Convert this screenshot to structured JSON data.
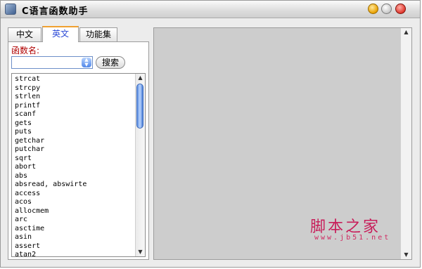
{
  "window": {
    "title": "C语言函数助手",
    "icon": "app-icon",
    "controls": [
      "minimize-button",
      "maximize-button",
      "close-button"
    ]
  },
  "tabs": [
    {
      "label": "中文",
      "active": false
    },
    {
      "label": "英文",
      "active": true
    },
    {
      "label": "功能集",
      "active": false
    }
  ],
  "search": {
    "label": "函数名:",
    "value": "",
    "button_label": "搜索"
  },
  "function_list": [
    "strcat",
    "strcpy",
    "strlen",
    "printf",
    "scanf",
    "gets",
    "puts",
    "getchar",
    "putchar",
    "sqrt",
    "abort",
    "abs",
    "absread, abswirte",
    "access",
    "acos",
    "allocmem",
    "arc",
    "asctime",
    "asin",
    "assert",
    "atan2"
  ],
  "watermark": {
    "text": "脚本之家",
    "url": "www.jb51.net"
  },
  "colors": {
    "tab_active_text": "#2c4ad6",
    "label_text": "#b00000",
    "content_bg": "#cdcdcd",
    "watermark": "#c81e5a"
  }
}
